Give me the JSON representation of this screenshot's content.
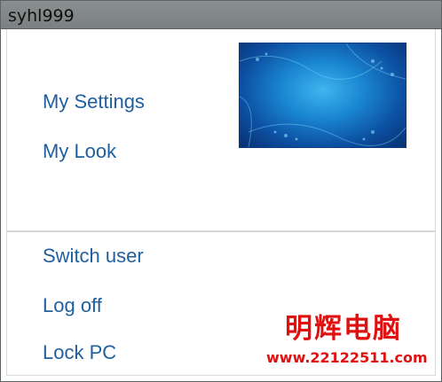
{
  "window": {
    "title": "syhl999"
  },
  "menu": {
    "top_items": [
      {
        "label": "My Settings"
      },
      {
        "label": "My Look"
      }
    ],
    "bottom_items": [
      {
        "label": "Switch user"
      },
      {
        "label": "Log off"
      },
      {
        "label": "Lock PC"
      }
    ]
  },
  "avatar": {
    "description_icon": "user-picture-icon"
  },
  "watermark": {
    "chinese_text": "明辉电脑",
    "url": "www.22122511.com"
  },
  "colors": {
    "link": "#1f5f9e",
    "titlebar": "#7b8081",
    "watermark": "#e01010"
  }
}
